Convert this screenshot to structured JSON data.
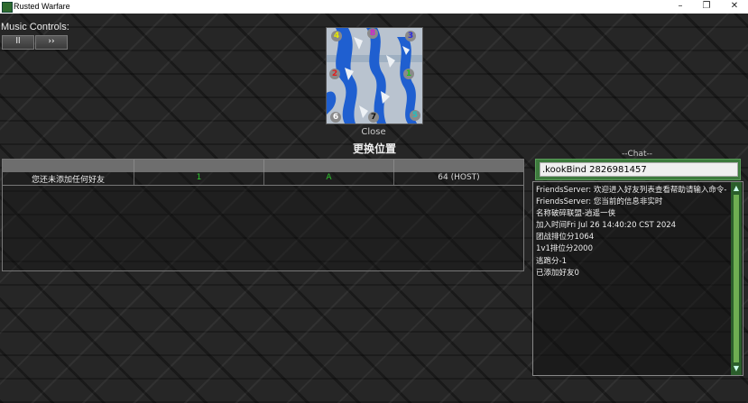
{
  "window": {
    "title": "Rusted Warfare",
    "minimize": "–",
    "restore": "❐",
    "close": "✕"
  },
  "music": {
    "label": "Music Controls:",
    "pause_label": "ll",
    "next_label": "››"
  },
  "map": {
    "slots": [
      {
        "num": "4",
        "color": "#e8e800"
      },
      {
        "num": "8",
        "color": "#d020d0"
      },
      {
        "num": "3",
        "color": "#2a2ae0"
      },
      {
        "num": "2",
        "color": "#e02020"
      },
      {
        "num": "1",
        "color": "#20c020"
      },
      {
        "num": "6",
        "color": "#ffffff"
      },
      {
        "num": "7",
        "color": "#111111"
      },
      {
        "num": "5",
        "color": "#20c0c0"
      }
    ],
    "close_label": "Close",
    "swap_label": "更换位置"
  },
  "players": {
    "headers": [
      "",
      "",
      "",
      ""
    ],
    "rows": [
      {
        "name": "您还未添加任何好友",
        "team": "1",
        "side": "A",
        "ping": "64 (HOST)"
      }
    ]
  },
  "chat": {
    "title": "--Chat--",
    "input_value": ".kookBind 2826981457",
    "lines": [
      "FriendsServer: 欢迎进入好友列表查看帮助请输入命令-h",
      "FriendsServer: 您当前的信息非实时",
      "名称破碎联盟-逍遥一侠",
      "加入时间Fri Jul 26 14:40:20 CST 2024",
      "团战排位分1064",
      "1v1排位分2000",
      "逃跑分-1",
      "已添加好友0"
    ],
    "scroll_up": "▲",
    "scroll_down": "▼"
  },
  "colors": {
    "accent_green": "#3d7a3d",
    "team_green": "#2ec92e"
  }
}
